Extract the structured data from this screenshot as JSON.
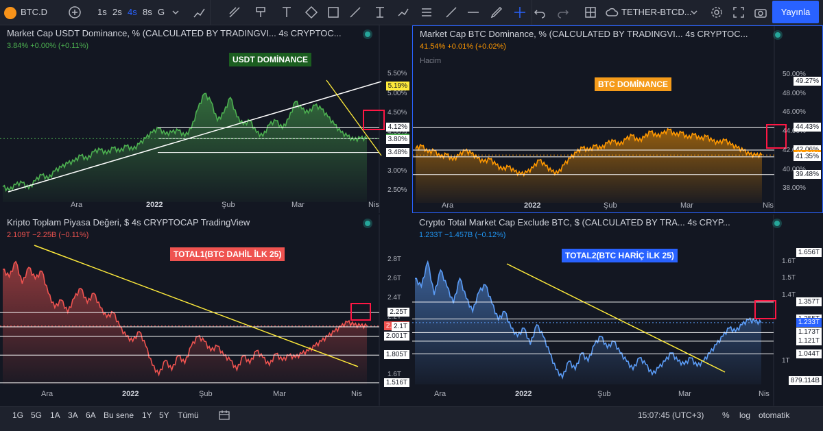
{
  "toolbar": {
    "symbol": "BTC.D",
    "intervals": [
      "1s",
      "2s",
      "4s",
      "8s",
      "G"
    ],
    "active_interval": "4s",
    "layout_name": "TETHER-BTCD...",
    "publish_label": "Yayınla",
    "icons": [
      "plus-icon",
      "bar-chart-icon",
      "cursor-icon",
      "trendline-icon",
      "brush-icon",
      "text-icon",
      "shape-icon",
      "rect-icon",
      "measure-icon",
      "fib-icon",
      "path-icon",
      "pattern-icon",
      "ruler-icon",
      "horizontal-line-icon",
      "pen-icon",
      "crosshair-icon",
      "undo-icon",
      "redo-icon",
      "grid-layout-icon",
      "cloud-icon",
      "gear-icon",
      "fullscreen-icon",
      "camera-icon"
    ]
  },
  "panels": [
    {
      "id": "usdt",
      "title": "Market Cap USDT Dominance, % (CALCULATED BY TRADINGVI...  4s  CRYPTOC...",
      "value_line": "3.84% +0.00% (+0.11%)",
      "value_color": "#4caf50",
      "label": "USDT DOMİNANCE",
      "label_bg": "#1b5e20",
      "label_color": "#ffffff",
      "color": "#4caf50",
      "ymin": 2.2,
      "ymax": 5.7,
      "ticks": [
        {
          "v": 5.5,
          "t": "5.50%"
        },
        {
          "v": 5.0,
          "t": "5.00%"
        },
        {
          "v": 4.5,
          "t": "4.50%"
        },
        {
          "v": 4.0,
          "t": "4.00%"
        },
        {
          "v": 3.5,
          "t": "3.50%"
        },
        {
          "v": 3.0,
          "t": "3.00%"
        },
        {
          "v": 2.5,
          "t": "2.50%"
        }
      ],
      "tags": [
        {
          "v": 5.19,
          "t": "5.19%",
          "bg": "#ffeb3b",
          "fg": "#131722"
        },
        {
          "v": 4.12,
          "t": "4.12%",
          "bg": "#ffffff",
          "fg": "#131722"
        },
        {
          "v": 3.84,
          "t": "3.84%",
          "bg": "#4caf50",
          "fg": "#ffffff"
        },
        {
          "v": 3.8,
          "t": "3.80%",
          "bg": "#ffffff",
          "fg": "#131722"
        },
        {
          "v": 3.48,
          "t": "3.48%",
          "bg": "#ffffff",
          "fg": "#131722"
        }
      ],
      "dates": [
        {
          "t": "Ara",
          "b": false
        },
        {
          "t": "2022",
          "b": true
        },
        {
          "t": "Şub",
          "b": false
        },
        {
          "t": "Mar",
          "b": false
        },
        {
          "t": "Nis",
          "b": false
        }
      ],
      "hlines": [
        4.12,
        3.84,
        3.48
      ],
      "series": [
        2.6,
        2.5,
        2.65,
        2.7,
        2.55,
        2.75,
        2.9,
        2.8,
        3.0,
        3.1,
        3.2,
        3.25,
        3.4,
        3.3,
        3.5,
        3.55,
        3.45,
        3.6,
        3.5,
        3.65,
        3.55,
        3.7,
        3.85,
        4.0,
        4.1,
        3.95,
        4.0,
        4.05,
        3.9,
        4.1,
        4.6,
        5.0,
        4.8,
        4.3,
        4.5,
        4.9,
        4.4,
        4.2,
        4.3,
        4.0,
        3.9,
        4.2,
        4.3,
        4.1,
        4.35,
        4.8,
        4.6,
        4.5,
        4.7,
        4.6,
        4.4,
        4.2,
        4.0,
        3.9,
        3.8,
        3.85,
        3.84
      ]
    },
    {
      "id": "btc",
      "title": "Market Cap BTC Dominance, % (CALCULATED BY TRADINGVI...  4s  CRYPTOC...",
      "value_line": "41.54% +0.01% (+0.02%)",
      "value_color": "#ff9800",
      "extra_line": "Hacim",
      "label": "BTC DOMİNANCE",
      "label_bg": "#f59b1a",
      "label_color": "#ffffff",
      "color": "#ff9800",
      "ymin": 36.5,
      "ymax": 50.8,
      "ticks": [
        {
          "v": 50,
          "t": "50.00%"
        },
        {
          "v": 48,
          "t": "48.00%"
        },
        {
          "v": 46,
          "t": "46.00%"
        },
        {
          "v": 44,
          "t": "44.00%"
        },
        {
          "v": 42,
          "t": "42.00%"
        },
        {
          "v": 40,
          "t": "40.00%"
        },
        {
          "v": 38,
          "t": "38.00%"
        }
      ],
      "tags": [
        {
          "v": 49.27,
          "t": "49.27%",
          "bg": "#ffffff",
          "fg": "#131722"
        },
        {
          "v": 44.43,
          "t": "44.43%",
          "bg": "#ffffff",
          "fg": "#131722"
        },
        {
          "v": 42.06,
          "t": "42.06%",
          "bg": "#ffffff",
          "fg": "#131722"
        },
        {
          "v": 41.54,
          "t": "41.54%",
          "bg": "#ff9800",
          "fg": "#ffffff"
        },
        {
          "v": 41.35,
          "t": "41.35%",
          "bg": "#ffffff",
          "fg": "#131722"
        },
        {
          "v": 39.48,
          "t": "39.48%",
          "bg": "#ffffff",
          "fg": "#131722"
        }
      ],
      "dates": [
        {
          "t": "Ara",
          "b": false
        },
        {
          "t": "2022",
          "b": true
        },
        {
          "t": "Şub",
          "b": false
        },
        {
          "t": "Mar",
          "b": false
        },
        {
          "t": "Nis",
          "b": false
        }
      ],
      "hlines": [
        44.43,
        42.06,
        41.35,
        39.48
      ],
      "series": [
        42.2,
        42.5,
        41.8,
        42.0,
        41.3,
        41.6,
        41.0,
        41.5,
        42.0,
        41.7,
        41.2,
        40.8,
        41.1,
        40.5,
        40.0,
        40.3,
        39.8,
        39.5,
        39.7,
        40.2,
        41.0,
        40.4,
        39.8,
        39.6,
        40.5,
        41.2,
        41.8,
        42.3,
        42.0,
        42.5,
        42.2,
        42.8,
        43.0,
        42.6,
        43.2,
        43.6,
        43.0,
        43.4,
        44.0,
        43.5,
        43.8,
        44.2,
        43.6,
        43.9,
        43.3,
        43.7,
        43.2,
        43.5,
        43.0,
        42.8,
        43.1,
        42.6,
        42.3,
        42.0,
        41.6,
        41.5,
        41.54
      ]
    },
    {
      "id": "total1",
      "title": "Kripto Toplam Piyasa Değeri, $  4s  CRYPTOCAP  TradingView",
      "value_line": "2.109T −2.25B (−0.11%)",
      "value_color": "#ef5350",
      "label": "TOTAL1(BTC DAHİL İLK 25)",
      "label_bg": "#ef5350",
      "label_color": "#ffffff",
      "color": "#ef5350",
      "ymin": 1.5,
      "ymax": 2.95,
      "ticks": [
        {
          "v": 2.8,
          "t": "2.8T"
        },
        {
          "v": 2.6,
          "t": "2.6T"
        },
        {
          "v": 2.4,
          "t": "2.4T"
        },
        {
          "v": 2.2,
          "t": "2.2T"
        },
        {
          "v": 1.6,
          "t": "1.6T"
        }
      ],
      "tags": [
        {
          "v": 2.25,
          "t": "2.25T",
          "bg": "#ffffff",
          "fg": "#131722"
        },
        {
          "v": 2.109,
          "t": "2.109T",
          "bg": "#ef5350",
          "fg": "#ffffff"
        },
        {
          "v": 2.1,
          "t": "2.1T",
          "bg": "#ffffff",
          "fg": "#131722"
        },
        {
          "v": 2.001,
          "t": "2.001T",
          "bg": "#ffffff",
          "fg": "#131722"
        },
        {
          "v": 1.805,
          "t": "1.805T",
          "bg": "#ffffff",
          "fg": "#131722"
        },
        {
          "v": 1.516,
          "t": "1.516T",
          "bg": "#ffffff",
          "fg": "#131722"
        }
      ],
      "dates": [
        {
          "t": "Ara",
          "b": false
        },
        {
          "t": "2022",
          "b": true
        },
        {
          "t": "Şub",
          "b": false
        },
        {
          "t": "Mar",
          "b": false
        },
        {
          "t": "Nis",
          "b": false
        }
      ],
      "hlines": [
        2.25,
        2.1,
        2.001,
        1.805,
        1.516
      ],
      "series": [
        2.7,
        2.62,
        2.78,
        2.55,
        2.72,
        2.6,
        2.68,
        2.45,
        2.3,
        2.38,
        2.25,
        2.4,
        2.5,
        2.35,
        2.45,
        2.3,
        2.2,
        2.25,
        2.1,
        2.0,
        1.95,
        2.05,
        1.9,
        1.7,
        1.6,
        1.75,
        1.65,
        1.8,
        1.72,
        1.9,
        2.0,
        1.95,
        1.85,
        1.9,
        1.8,
        1.75,
        1.65,
        1.8,
        1.72,
        1.85,
        1.78,
        1.7,
        1.82,
        1.75,
        1.8,
        1.78,
        1.82,
        1.85,
        1.9,
        1.95,
        2.0,
        2.05,
        2.1,
        2.15,
        2.12,
        2.11,
        2.109
      ]
    },
    {
      "id": "total2",
      "title": "Crypto Total Market Cap Exclude BTC, $ (CALCULATED BY TRA...  4s  CRYP...",
      "value_line": "1.233T −1.457B (−0.12%)",
      "value_color": "#2196f3",
      "label": "TOTAL2(BTC HARİÇ İLK 25)",
      "label_bg": "#2962ff",
      "label_color": "#ffffff",
      "color": "#5b9cf6",
      "ymin": 0.86,
      "ymax": 1.7,
      "ticks": [
        {
          "v": 1.6,
          "t": "1.6T"
        },
        {
          "v": 1.5,
          "t": "1.5T"
        },
        {
          "v": 1.4,
          "t": "1.4T"
        },
        {
          "v": 1.0,
          "t": "1T"
        }
      ],
      "tags": [
        {
          "v": 1.656,
          "t": "1.656T",
          "bg": "#ffffff",
          "fg": "#131722"
        },
        {
          "v": 1.357,
          "t": "1.357T",
          "bg": "#ffffff",
          "fg": "#131722"
        },
        {
          "v": 1.255,
          "t": "1.255T",
          "bg": "#ffffff",
          "fg": "#131722"
        },
        {
          "v": 1.233,
          "t": "1.233T",
          "bg": "#2962ff",
          "fg": "#ffffff"
        },
        {
          "v": 1.173,
          "t": "1.173T",
          "bg": "#ffffff",
          "fg": "#131722"
        },
        {
          "v": 1.121,
          "t": "1.121T",
          "bg": "#ffffff",
          "fg": "#131722"
        },
        {
          "v": 1.044,
          "t": "1.044T",
          "bg": "#ffffff",
          "fg": "#131722"
        },
        {
          "v": 0.879,
          "t": "879.114B",
          "bg": "#ffffff",
          "fg": "#131722"
        }
      ],
      "dates": [
        {
          "t": "Ara",
          "b": false
        },
        {
          "t": "2022",
          "b": true
        },
        {
          "t": "Şub",
          "b": false
        },
        {
          "t": "Mar",
          "b": false
        },
        {
          "t": "Nis",
          "b": false
        }
      ],
      "hlines": [
        1.357,
        1.255,
        1.173,
        1.121,
        1.044
      ],
      "series": [
        1.5,
        1.45,
        1.6,
        1.4,
        1.55,
        1.45,
        1.35,
        1.5,
        1.38,
        1.3,
        1.42,
        1.46,
        1.35,
        1.25,
        1.3,
        1.2,
        1.15,
        1.2,
        1.1,
        1.22,
        1.15,
        1.05,
        0.95,
        0.9,
        1.0,
        0.95,
        1.05,
        1.0,
        1.1,
        1.15,
        1.08,
        1.12,
        1.05,
        1.0,
        0.95,
        1.02,
        0.98,
        0.92,
        0.96,
        1.0,
        1.05,
        1.0,
        0.98,
        1.02,
        0.97,
        1.0,
        1.05,
        1.1,
        1.15,
        1.2,
        1.18,
        1.22,
        1.25,
        1.24,
        1.233
      ]
    }
  ],
  "bottombar": {
    "ranges": [
      "1G",
      "5G",
      "1A",
      "3A",
      "6A",
      "Bu sene",
      "1Y",
      "5Y",
      "Tümü"
    ],
    "clock": "15:07:45 (UTC+3)",
    "percent": "%",
    "log": "log",
    "auto": "otomatik"
  }
}
